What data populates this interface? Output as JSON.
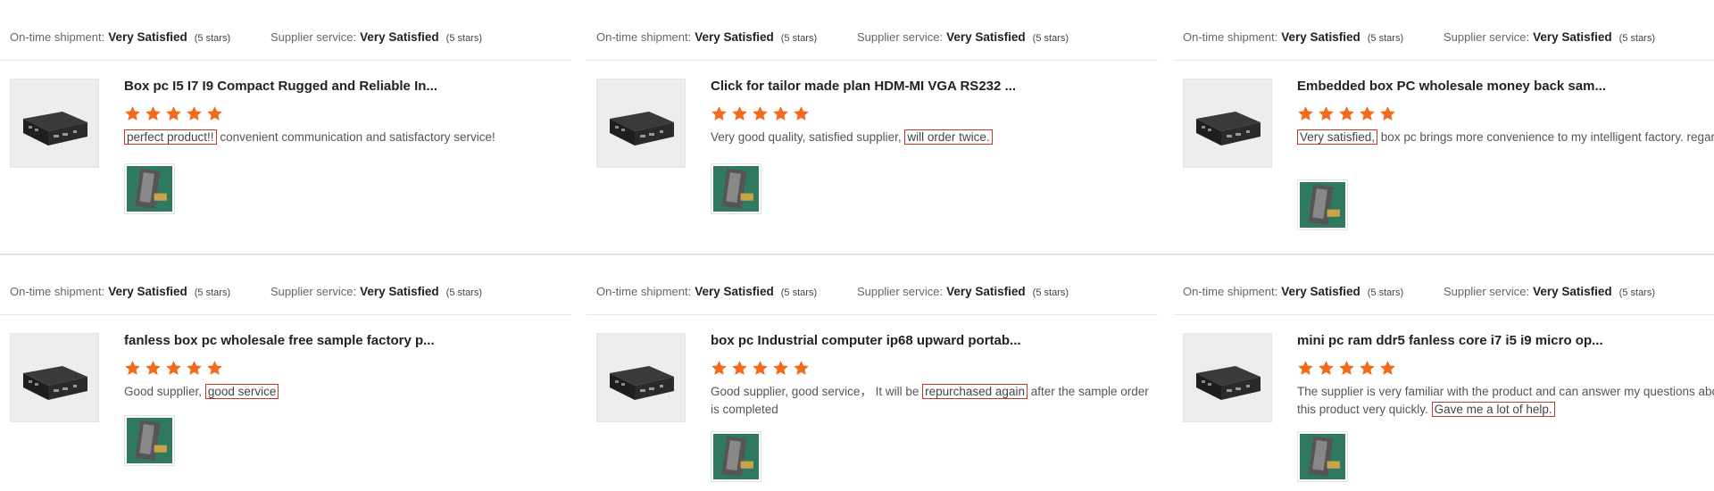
{
  "ratings_labels": {
    "shipment": "On-time shipment:",
    "service": "Supplier service:",
    "value": "Very Satisfied",
    "stars": "(5 stars)"
  },
  "star_color": "#f26a1b",
  "highlight_color": "#c0392b",
  "reviews": [
    {
      "title": "Box pc I5 I7 I9 Compact Rugged and Reliable In...",
      "rating": 5,
      "before": "",
      "highlight": "perfect product!!",
      "after": " convenient communication and satisfactory service!"
    },
    {
      "title": "Click for tailor made plan HDM-MI VGA RS232 ...",
      "rating": 5,
      "before": "Very good quality, satisfied supplier, ",
      "highlight": "will order twice.",
      "after": ""
    },
    {
      "title": "Embedded box PC wholesale money back sam...",
      "rating": 5,
      "before": "",
      "highlight": "Very satisfied,",
      "after": " box pc brings more convenience to my intelligent factory. regards."
    },
    {
      "title": "fanless box pc wholesale free sample factory p...",
      "rating": 5,
      "before": "Good supplier, ",
      "highlight": "good service",
      "after": ""
    },
    {
      "title": "box pc Industrial computer ip68 upward portab...",
      "rating": 5,
      "before": "Good supplier, good service，  It will be ",
      "highlight": "repurchased again",
      "after": " after the sample order is completed"
    },
    {
      "title": "mini pc ram ddr5 fanless core i7 i5 i9 micro op...",
      "rating": 5,
      "before": "The supplier is very familiar with the product and can answer my questions about this product very quickly. ",
      "highlight": "Gave me a lot of help.",
      "after": ""
    }
  ]
}
